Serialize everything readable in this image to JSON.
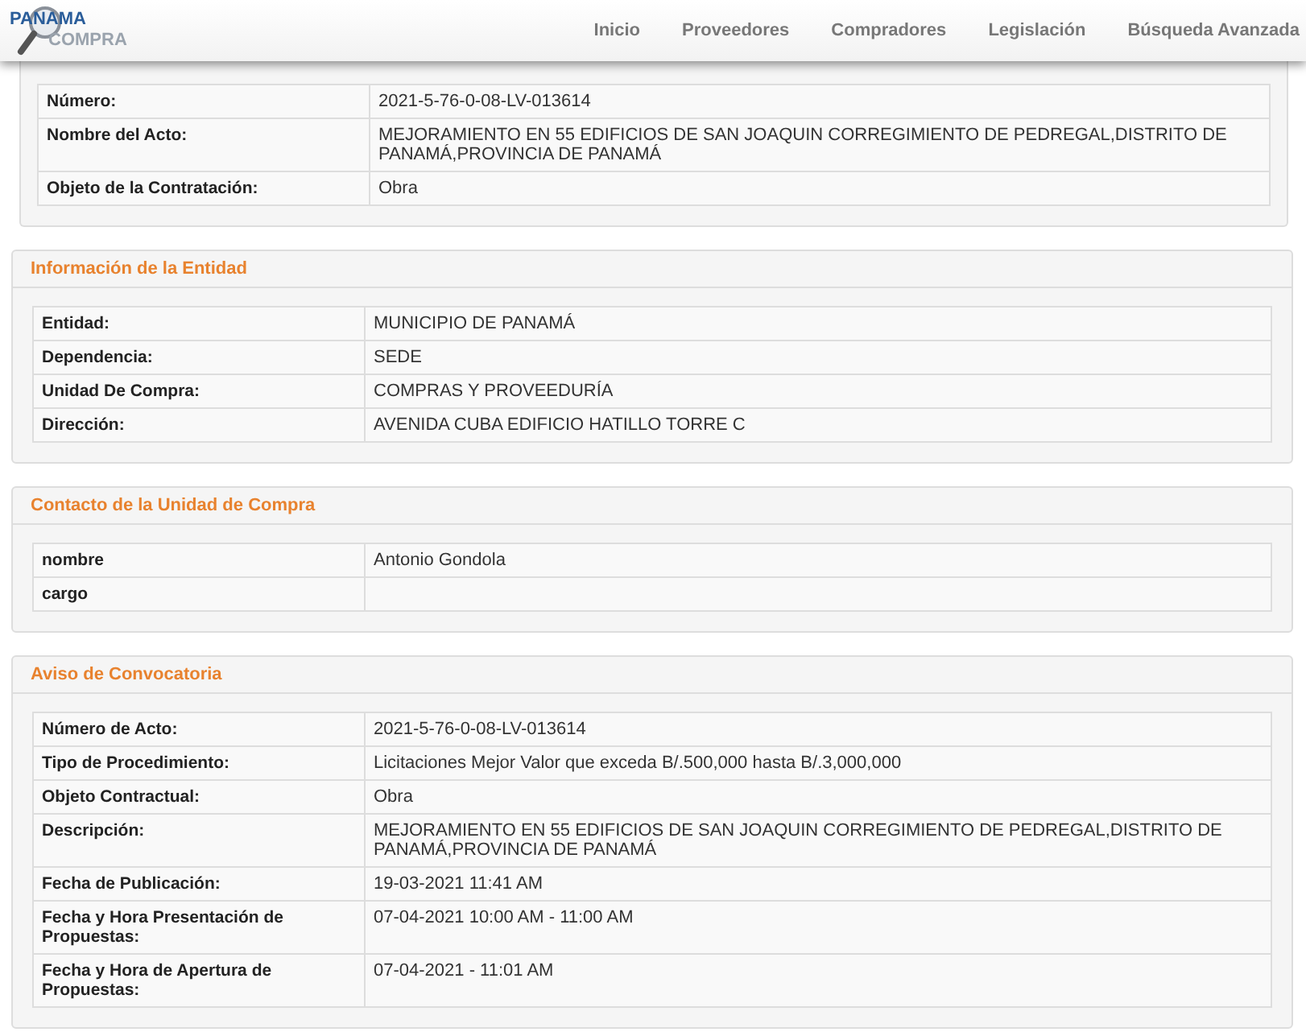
{
  "header": {
    "logo": [
      "PANAMA",
      "COMPRA"
    ],
    "nav": [
      {
        "label": "Inicio"
      },
      {
        "label": "Proveedores"
      },
      {
        "label": "Compradores"
      },
      {
        "label": "Legislación"
      },
      {
        "label": "Búsqueda Avanzada"
      }
    ]
  },
  "sections": [
    {
      "rows": [
        {
          "label": "Número:",
          "value": "2021-5-76-0-08-LV-013614"
        },
        {
          "label": "Nombre del Acto:",
          "value": "MEJORAMIENTO EN 55 EDIFICIOS DE SAN JOAQUIN CORREGIMIENTO DE PEDREGAL,DISTRITO DE PANAMÁ,PROVINCIA DE PANAMÁ"
        },
        {
          "label": "Objeto de la Contratación:",
          "value": "Obra"
        }
      ]
    },
    {
      "title": "Información de la Entidad",
      "rows": [
        {
          "label": "Entidad:",
          "value": "MUNICIPIO DE PANAMÁ"
        },
        {
          "label": "Dependencia:",
          "value": "SEDE"
        },
        {
          "label": "Unidad De Compra:",
          "value": "COMPRAS Y PROVEEDURÍA"
        },
        {
          "label": "Dirección:",
          "value": "AVENIDA CUBA EDIFICIO HATILLO TORRE C"
        }
      ]
    },
    {
      "title": "Contacto de la Unidad de Compra",
      "rows": [
        {
          "label": "nombre",
          "value": "Antonio Gondola"
        },
        {
          "label": "cargo"
        }
      ]
    },
    {
      "title": "Aviso de Convocatoria",
      "rows": [
        {
          "label": "Número de Acto:",
          "value": "2021-5-76-0-08-LV-013614"
        },
        {
          "label": "Tipo de Procedimiento:",
          "value": "Licitaciones Mejor Valor que exceda B/.500,000 hasta B/.3,000,000"
        },
        {
          "label": "Objeto Contractual:",
          "value": "Obra"
        },
        {
          "label": "Descripción:",
          "value": "MEJORAMIENTO EN 55 EDIFICIOS DE SAN JOAQUIN CORREGIMIENTO DE PEDREGAL,DISTRITO DE PANAMÁ,PROVINCIA DE PANAMÁ"
        },
        {
          "label": "Fecha de Publicación:",
          "value": "19-03-2021 11:41 AM"
        },
        {
          "label": "Fecha y Hora Presentación de Propuestas:",
          "value": "07-04-2021 10:00 AM - 11:00 AM"
        },
        {
          "label": "Fecha y Hora de Apertura de Propuestas:",
          "value": "07-04-2021 - 11:01 AM"
        }
      ]
    }
  ]
}
